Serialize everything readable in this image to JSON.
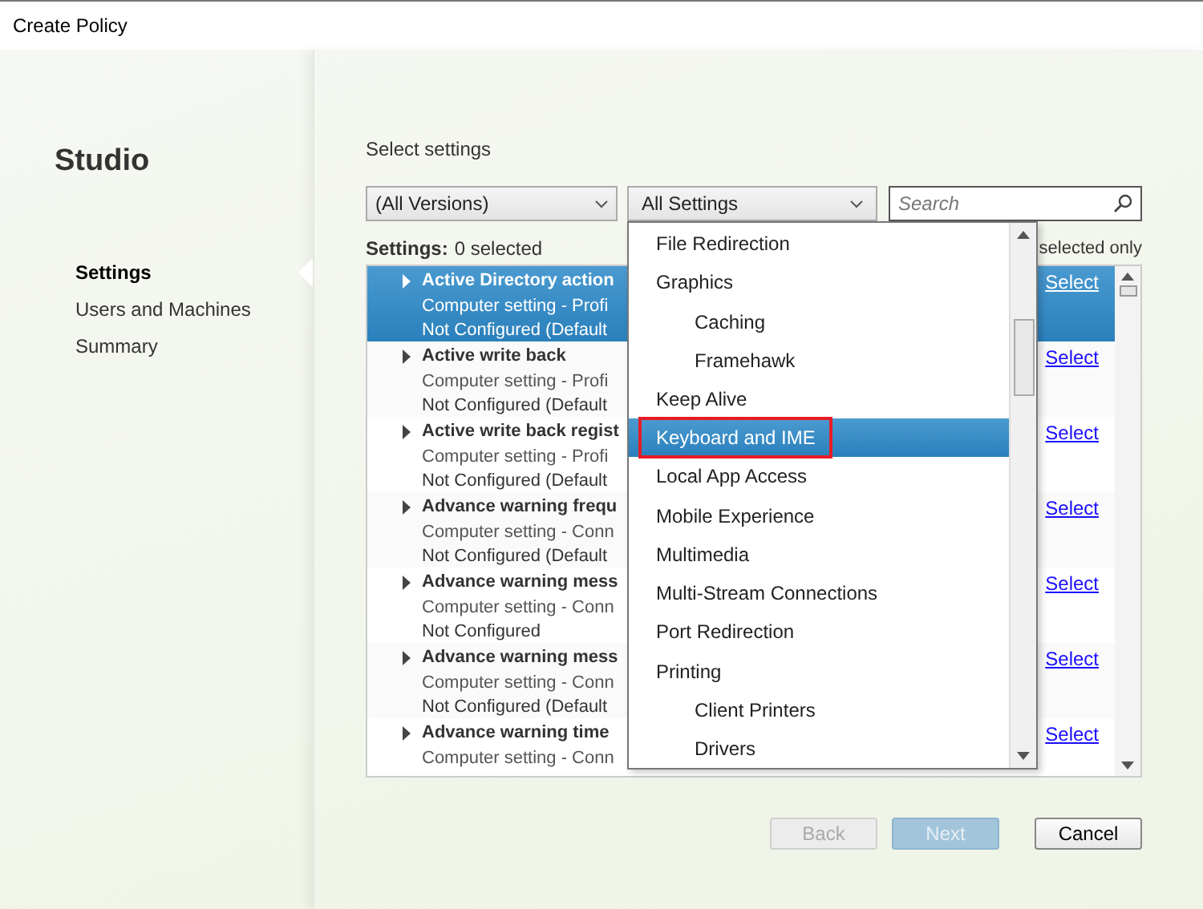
{
  "window": {
    "title": "Create Policy"
  },
  "sidebar": {
    "title": "Studio",
    "items": [
      {
        "label": "Settings",
        "selected": true
      },
      {
        "label": "Users and Machines",
        "selected": false
      },
      {
        "label": "Summary",
        "selected": false
      }
    ]
  },
  "heading": "Select settings",
  "filters": {
    "version": "(All Versions)",
    "category": "All Settings",
    "search": {
      "placeholder": "Search"
    }
  },
  "settings_count": {
    "label": "Settings:",
    "value": "0 selected"
  },
  "show_selected_label": "selected only",
  "settings": [
    {
      "name": "Active Directory action",
      "type": "Computer setting - Profi",
      "state": "Not Configured (Default",
      "selected": true,
      "link": "Select"
    },
    {
      "name": "Active write back",
      "type": "Computer setting - Profi",
      "state": "Not Configured (Default",
      "selected": false,
      "link": "Select"
    },
    {
      "name": "Active write back regist",
      "type": "Computer setting - Profi",
      "state": "Not Configured (Default",
      "selected": false,
      "link": "Select"
    },
    {
      "name": "Advance warning frequ",
      "type": "Computer setting - Conn",
      "state": "Not Configured (Default",
      "selected": false,
      "link": "Select"
    },
    {
      "name": "Advance warning mess",
      "type": "Computer setting - Conn",
      "state": "Not Configured",
      "selected": false,
      "link": "Select"
    },
    {
      "name": "Advance warning mess",
      "type": "Computer setting - Conn",
      "state": "Not Configured (Default",
      "selected": false,
      "link": "Select"
    },
    {
      "name": "Advance warning time",
      "type": "Computer setting - Conn",
      "selected": false,
      "link": "Select"
    }
  ],
  "category_menu": [
    {
      "label": "File Redirection",
      "selected": false
    },
    {
      "label": "Graphics",
      "selected": false,
      "children": [
        {
          "label": "Caching",
          "selected": false
        },
        {
          "label": "Framehawk",
          "selected": false
        }
      ]
    },
    {
      "label": "Keep Alive",
      "selected": false
    },
    {
      "label": "Keyboard and IME",
      "selected": true,
      "outlined": true
    },
    {
      "label": "Local App Access",
      "selected": false
    },
    {
      "label": "Mobile Experience",
      "selected": false
    },
    {
      "label": "Multimedia",
      "selected": false
    },
    {
      "label": "Multi-Stream Connections",
      "selected": false
    },
    {
      "label": "Port Redirection",
      "selected": false
    },
    {
      "label": "Printing",
      "selected": false,
      "children": [
        {
          "label": "Client Printers",
          "selected": false
        },
        {
          "label": "Drivers",
          "selected": false
        }
      ]
    }
  ],
  "buttons": [
    {
      "label": "Back",
      "disabled": true,
      "kind": "secondary"
    },
    {
      "label": "Next",
      "disabled": true,
      "kind": "primary"
    },
    {
      "label": "Cancel",
      "disabled": false,
      "kind": "secondary"
    }
  ]
}
